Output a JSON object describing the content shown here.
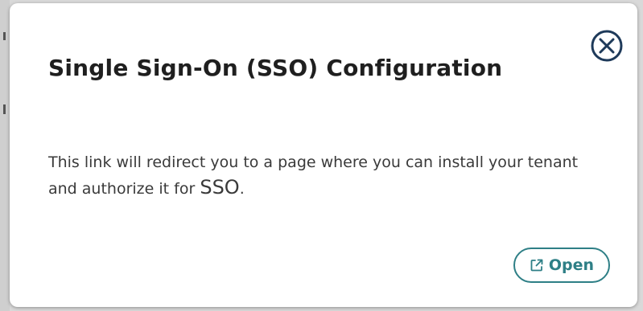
{
  "dialog": {
    "title": "Single Sign-On (SSO) Configuration",
    "body_main": "This link will redirect you to a page where you can install your tenant and authorize it for",
    "body_emph": "SSO",
    "body_end": ".",
    "close_icon": "close-circle-x-icon",
    "open_button": {
      "label": "Open",
      "icon": "external-link-icon"
    }
  },
  "colors": {
    "accent": "#2e7f86",
    "title": "#1f1f1f",
    "body": "#3a3a3a",
    "close_icon": "#1e3a5a"
  }
}
